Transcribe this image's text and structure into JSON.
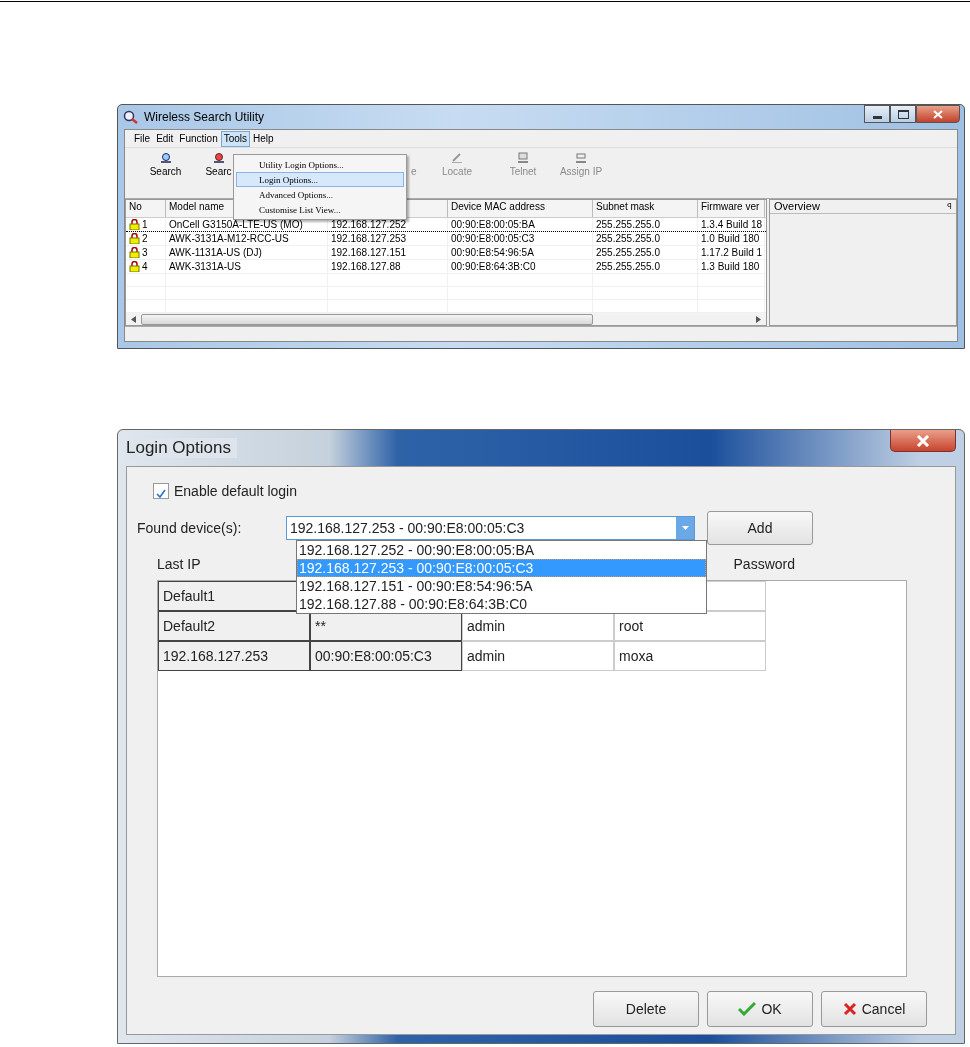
{
  "utility_window": {
    "title": "Wireless Search Utility",
    "menu": [
      {
        "label": "File",
        "selected": false
      },
      {
        "label": "Edit",
        "selected": false
      },
      {
        "label": "Function",
        "selected": false
      },
      {
        "label": "Tools",
        "selected": true
      },
      {
        "label": "Help",
        "selected": false
      }
    ],
    "toolbar": [
      {
        "label": "Search",
        "kind": "search",
        "disabled": false
      },
      {
        "label": "Searc",
        "kind": "search-alt",
        "disabled": false
      },
      {
        "label": "e",
        "kind": "blank",
        "disabled": true
      },
      {
        "label": "Locate",
        "kind": "locate",
        "disabled": true
      },
      {
        "label": "Telnet",
        "kind": "telnet",
        "disabled": true
      },
      {
        "label": "Assign IP",
        "kind": "ip",
        "disabled": true
      }
    ],
    "tools_menu": [
      {
        "label": "Utility Login Options...",
        "selected": false
      },
      {
        "label": "Login Options...",
        "selected": true
      },
      {
        "label": "Advanced Options...",
        "selected": false
      },
      {
        "label": "Customise List View...",
        "selected": false
      }
    ],
    "table": {
      "columns": [
        "No",
        "Model name",
        null,
        "Device MAC address",
        "Subnet mask",
        "Firmware ver"
      ],
      "rows": [
        {
          "no": "1",
          "model": "OnCell G3150A-LTE-US (MO)",
          "ip": "192.168.127.252",
          "mac": "00:90:E8:00:05:BA",
          "mask": "255.255.255.0",
          "firmware": "1.3.4 Build 18",
          "focused": false
        },
        {
          "no": "2",
          "model": "AWK-3131A-M12-RCC-US",
          "ip": "192.168.127.253",
          "mac": "00:90:E8:00:05:C3",
          "mask": "255.255.255.0",
          "firmware": "1.0 Build 180",
          "focused": true
        },
        {
          "no": "3",
          "model": "AWK-1131A-US (DJ)",
          "ip": "192.168.127.151",
          "mac": "00:90:E8:54:96:5A",
          "mask": "255.255.255.0",
          "firmware": "1.17.2 Build 1",
          "focused": false
        },
        {
          "no": "4",
          "model": "AWK-3131A-US",
          "ip": "192.168.127.88",
          "mac": "00:90:E8:64:3B:C0",
          "mask": "255.255.255.0",
          "firmware": "1.3 Build 180",
          "focused": false
        }
      ]
    },
    "overview": {
      "title": "Overview",
      "pin": "ꟼ"
    }
  },
  "login_dialog": {
    "title": "Login Options",
    "enable_default_login": {
      "label": "Enable default login",
      "checked": true
    },
    "found_devices": {
      "label": "Found device(s):",
      "value": "192.168.127.253 - 00:90:E8:00:05:C3",
      "options": [
        {
          "label": "192.168.127.252 - 00:90:E8:00:05:BA",
          "selected": false
        },
        {
          "label": "192.168.127.253 - 00:90:E8:00:05:C3",
          "selected": true
        },
        {
          "label": "192.168.127.151 - 00:90:E8:54:96:5A",
          "selected": false
        },
        {
          "label": "192.168.127.88 - 00:90:E8:64:3B:C0",
          "selected": false
        }
      ]
    },
    "add_button": "Add",
    "column_headers": {
      "last_ip": "Last IP",
      "password": "Password"
    },
    "rows": [
      {
        "last_ip": "Default1"
      },
      {
        "last_ip": "Default2",
        "mac": "**",
        "user": "admin",
        "password": "root"
      },
      {
        "last_ip": "192.168.127.253",
        "mac": "00:90:E8:00:05:C3",
        "user": "admin",
        "password": "moxa"
      }
    ],
    "buttons": [
      {
        "label": "Delete",
        "kind": "plain"
      },
      {
        "label": "OK",
        "kind": "ok"
      },
      {
        "label": "Cancel",
        "kind": "cancel"
      }
    ]
  }
}
